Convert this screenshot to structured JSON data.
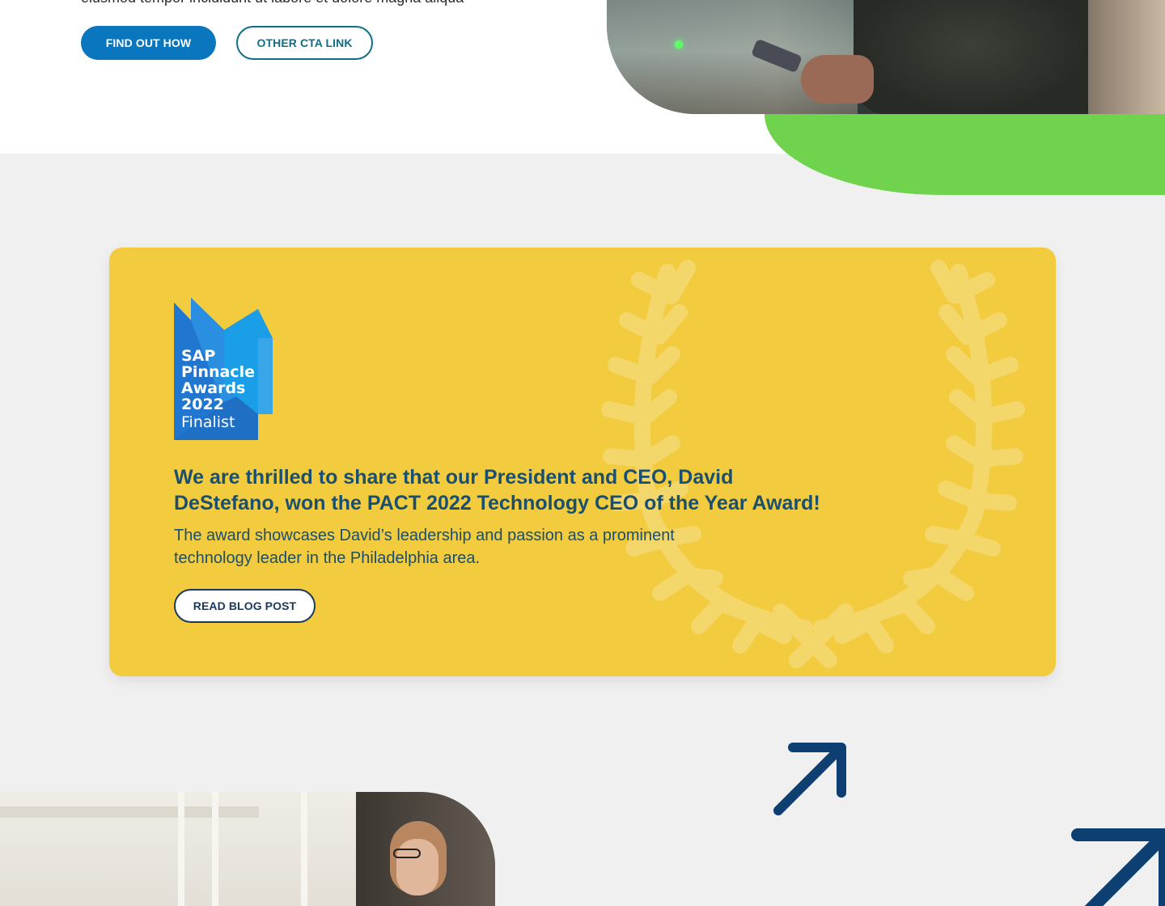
{
  "hero": {
    "intro_text": "eiusmod tempor incididunt ut labore et dolore magna aliqua",
    "primary_button": "FIND OUT HOW",
    "secondary_button": "OTHER CTA LINK"
  },
  "award": {
    "badge": {
      "line1": "SAP",
      "line2": "Pinnacle",
      "line3": "Awards",
      "line4": "2022",
      "line5": "Finalist"
    },
    "heading": "We are thrilled to share that our President and CEO, David DeStefano, won the PACT 2022 Technology CEO of the Year Award!",
    "body": "The award showcases David’s leadership and passion as a prominent technology leader in the Philadelphia area.",
    "button": "READ BLOG POST"
  },
  "colors": {
    "page_bg": "#f0f0f0",
    "primary_blue": "#0a76bd",
    "teal_outline": "#0e6f86",
    "green_accent": "#6fd34e",
    "card_yellow": "#f2cb3f",
    "heading_navy": "#1a4f6e",
    "arrow_navy": "#0d3f73"
  },
  "icons": {
    "laurel": "laurel-wreath-icon",
    "arrow_small": "arrow-up-right-icon",
    "arrow_large": "arrow-up-right-icon"
  }
}
